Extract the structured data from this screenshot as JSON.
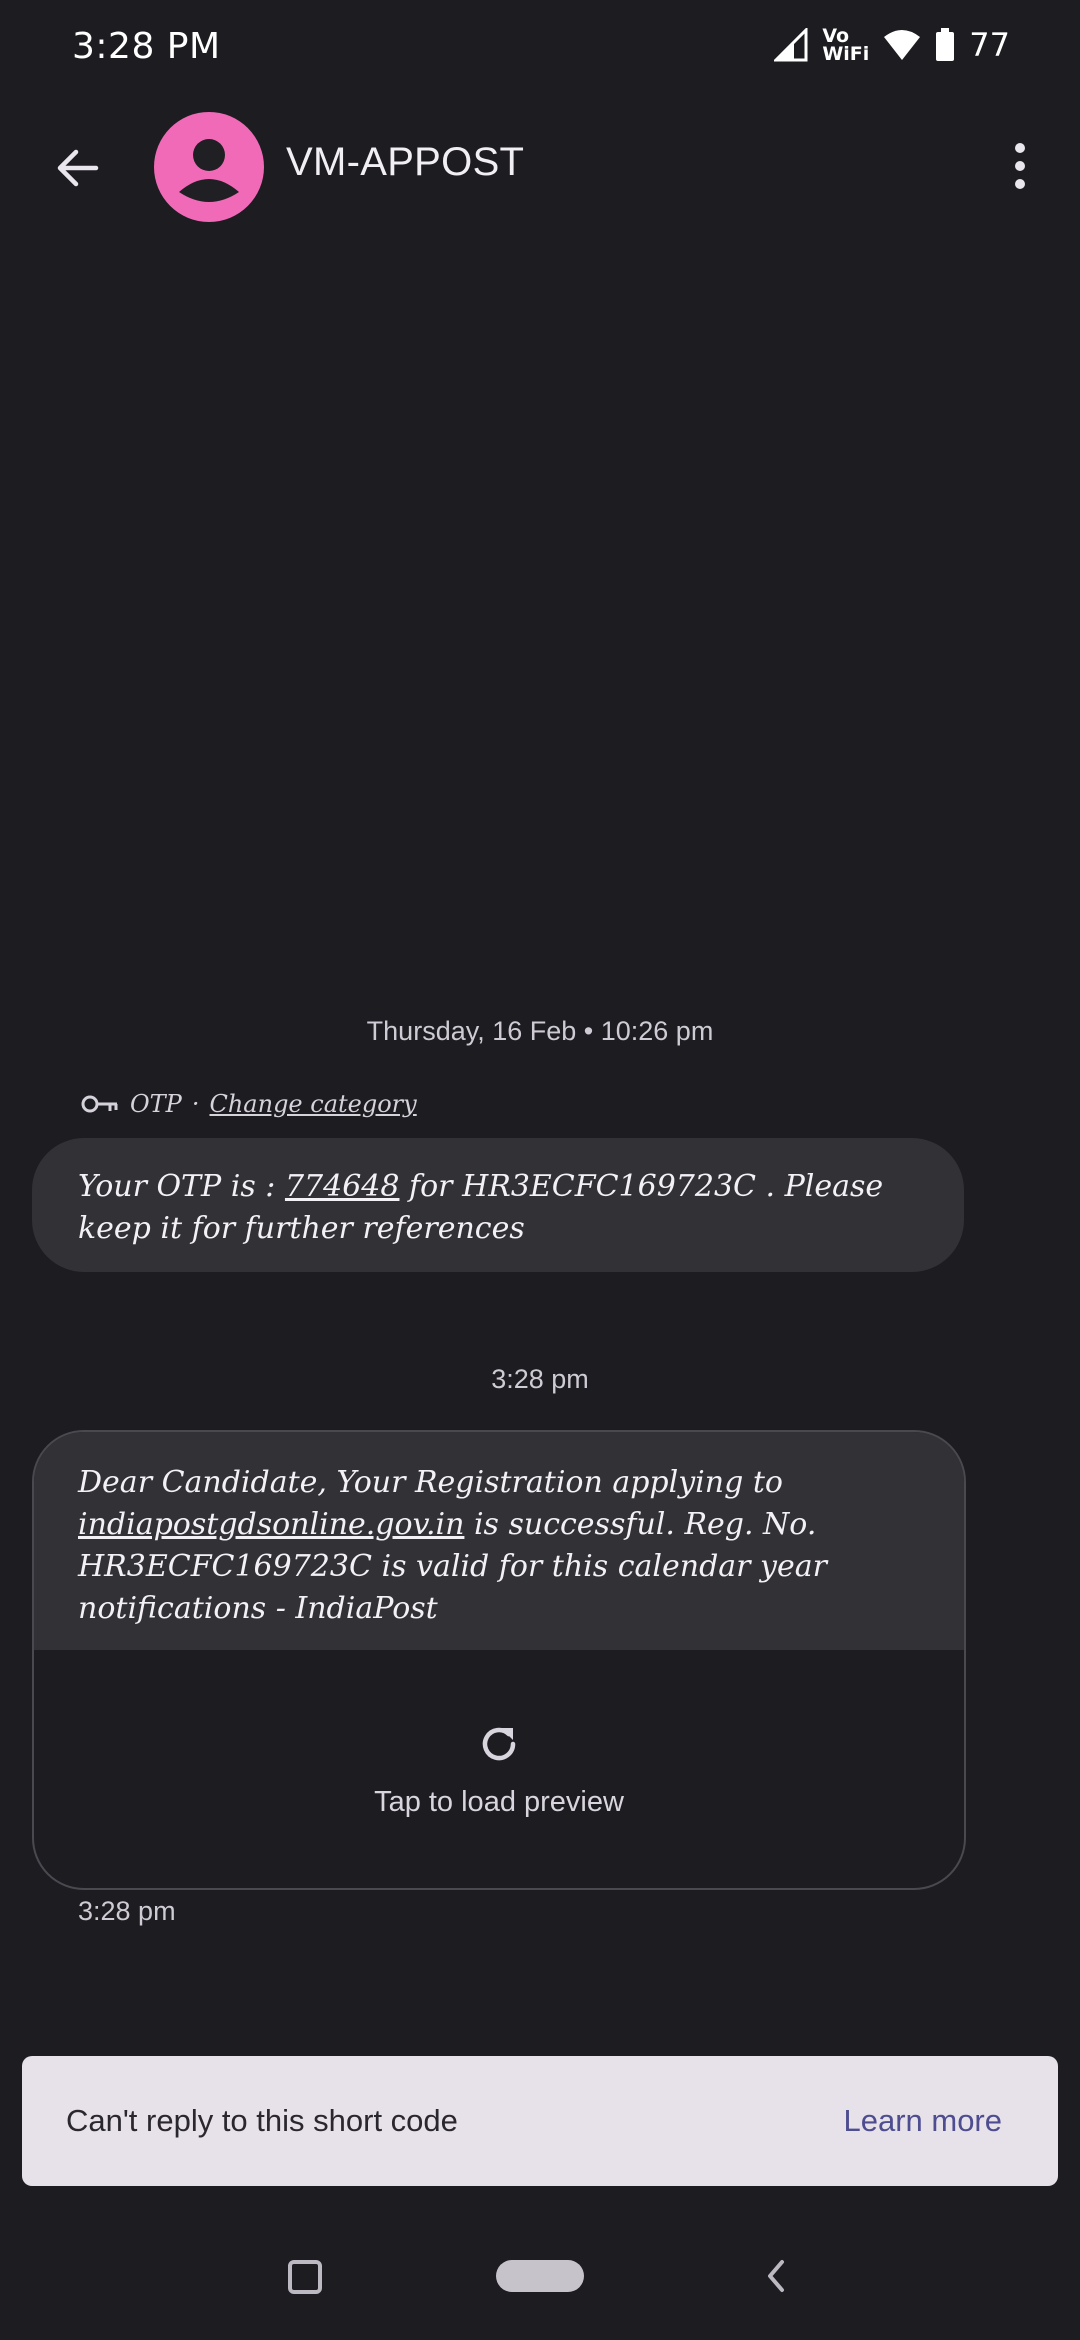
{
  "status_bar": {
    "time": "3:28 PM",
    "vowifi_top": "Vo",
    "vowifi_bottom": "WiFi",
    "battery": "77"
  },
  "app_bar": {
    "title": "VM-APPOST",
    "avatar_color": "#f06ab8"
  },
  "conversation": {
    "date_header": "Thursday, 16 Feb • 10:26 pm",
    "category": {
      "label": "OTP",
      "separator": "·",
      "action": "Change category"
    },
    "message1": {
      "prefix": "Your OTP is : ",
      "otp": "774648",
      "suffix": " for HR3ECFC169723C . Please keep it for further references"
    },
    "time_header_2": "3:28 pm",
    "message2": {
      "text_a": "Dear Candidate, Your Registration applying to ",
      "link": "indiapostgdsonline.gov.in",
      "text_b": " is successful. Reg. No. HR3ECFC169723C is valid for this calendar year notifications - IndiaPost",
      "preview_label": "Tap to load preview",
      "timestamp": "3:28 pm"
    }
  },
  "banner": {
    "text": "Can't reply to this short code",
    "link": "Learn more"
  }
}
